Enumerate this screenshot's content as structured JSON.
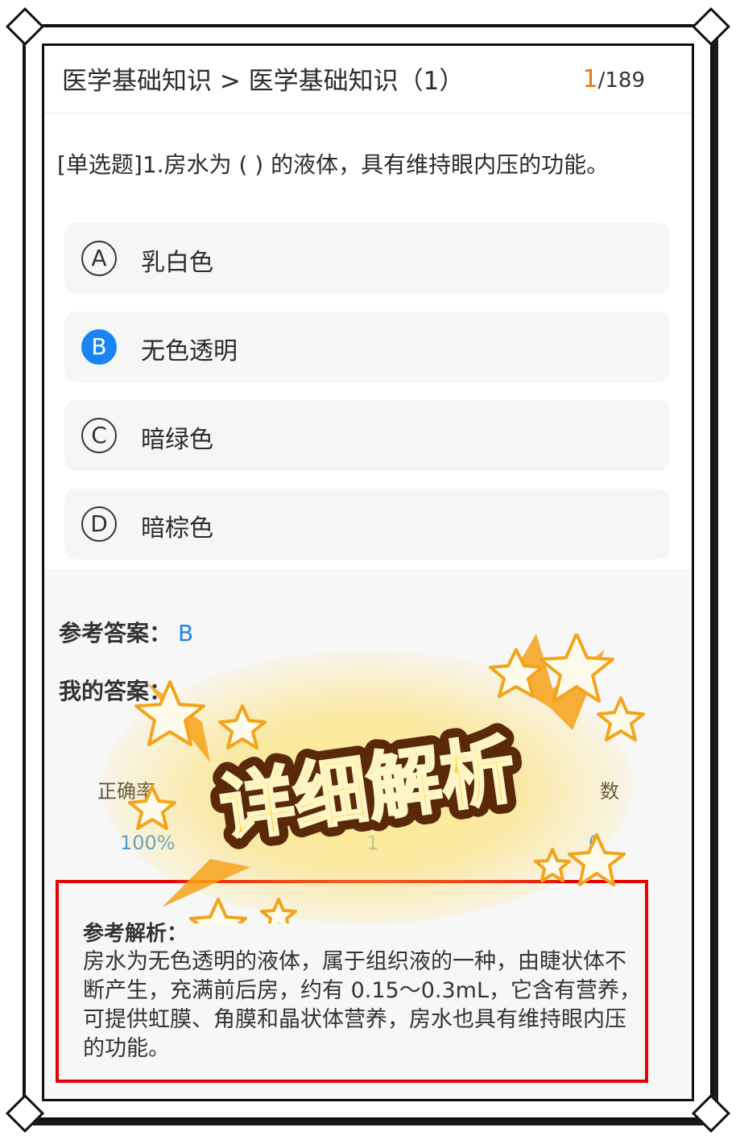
{
  "header": {
    "breadcrumb": "医学基础知识 > 医学基础知识（1）",
    "current": "1",
    "total": "/189"
  },
  "question": {
    "text": "[单选题]1.房水为 ( ) 的液体，具有维持眼内压的功能。",
    "options": [
      {
        "letter": "A",
        "text": "乳白色",
        "selected": false
      },
      {
        "letter": "B",
        "text": "无色透明",
        "selected": true
      },
      {
        "letter": "C",
        "text": "暗绿色",
        "selected": false
      },
      {
        "letter": "D",
        "text": "暗棕色",
        "selected": false
      }
    ]
  },
  "answer": {
    "reference_label": "参考答案：",
    "reference_value": "B",
    "mine_label": "我的答案：",
    "mine_value": ""
  },
  "stats": {
    "accuracy_label": "正确率",
    "accuracy_value": "100%",
    "count_value": "1",
    "error_label": "数",
    "error_value": "0"
  },
  "explanation": {
    "title": "参考解析：",
    "text": "房水为无色透明的液体，属于组织液的一种，由睫状体不断产生，充满前后房，约有 0.15～0.3mL，它含有营养，可提供虹膜、角膜和晶状体营养，房水也具有维持眼内压的功能。"
  },
  "badge": {
    "text": "详细解析"
  },
  "colors": {
    "accent_blue": "#1a85f0",
    "counter_orange": "#e07a12",
    "highlight_red": "#e60000",
    "badge_yellow": "#ffcc1a"
  }
}
